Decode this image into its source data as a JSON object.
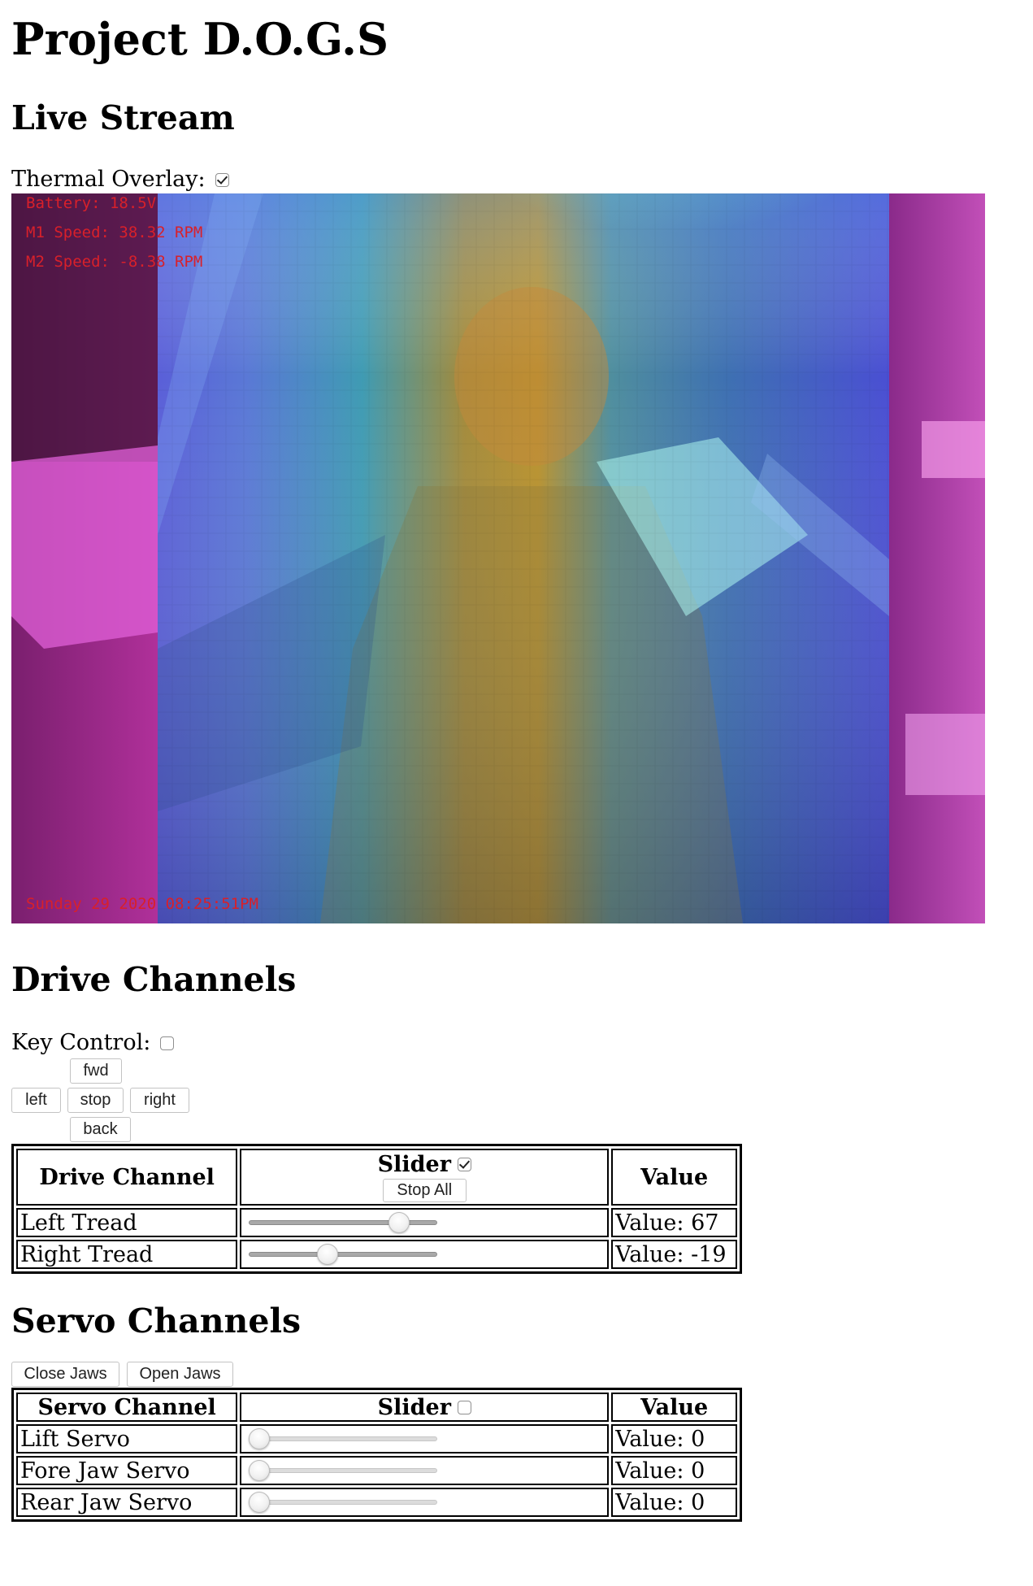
{
  "page": {
    "title": "Project D.O.G.S"
  },
  "live_stream": {
    "heading": "Live Stream",
    "thermal_overlay_label": "Thermal Overlay:",
    "thermal_overlay_checked": true,
    "osd": {
      "battery": "Battery: 18.5V",
      "m1_speed": "M1 Speed: 38.32 RPM",
      "m2_speed": "M2 Speed: -8.38 RPM",
      "timestamp": "Sunday 29 2020 08:25:51PM"
    }
  },
  "drive": {
    "heading": "Drive Channels",
    "key_control_label": "Key Control:",
    "key_control_checked": false,
    "buttons": {
      "fwd": "fwd",
      "left": "left",
      "stop": "stop",
      "right": "right",
      "back": "back"
    },
    "table": {
      "col_channel": "Drive Channel",
      "col_slider": "Slider",
      "slider_checked": true,
      "stop_all": "Stop All",
      "col_value": "Value",
      "rows": [
        {
          "name": "Left Tread",
          "value_text": "Value: 67",
          "value": 67,
          "min": -100,
          "max": 100
        },
        {
          "name": "Right Tread",
          "value_text": "Value: -19",
          "value": -19,
          "min": -100,
          "max": 100
        }
      ]
    }
  },
  "servo": {
    "heading": "Servo Channels",
    "buttons": {
      "close_jaws": "Close Jaws",
      "open_jaws": "Open Jaws"
    },
    "table": {
      "col_channel": "Servo Channel",
      "col_slider": "Slider",
      "slider_checked": false,
      "col_value": "Value",
      "rows": [
        {
          "name": "Lift Servo",
          "value_text": "Value: 0",
          "value": 0,
          "min": 0,
          "max": 180
        },
        {
          "name": "Fore Jaw Servo",
          "value_text": "Value: 0",
          "value": 0,
          "min": 0,
          "max": 180
        },
        {
          "name": "Rear Jaw Servo",
          "value_text": "Value: 0",
          "value": 0,
          "min": 0,
          "max": 180
        }
      ]
    }
  }
}
